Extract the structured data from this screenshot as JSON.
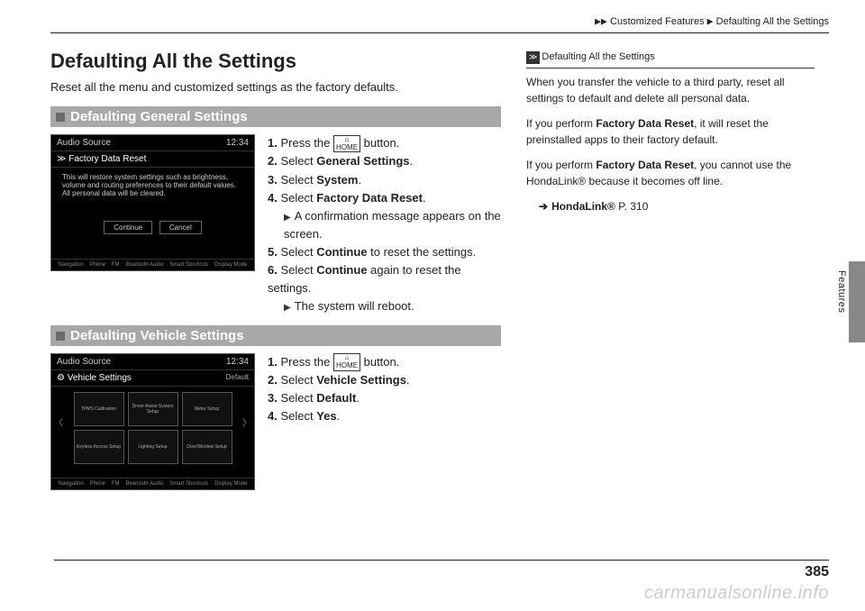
{
  "breadcrumb": {
    "level1": "Customized Features",
    "level2": "Defaulting All the Settings"
  },
  "title": "Defaulting All the Settings",
  "intro": "Reset all the menu and customized settings as the factory defaults.",
  "section1": {
    "heading": "Defaulting General Settings",
    "screenshot": {
      "audio_label": "Audio Source",
      "time": "12:34",
      "title_prefix": "≫",
      "title": "Factory Data Reset",
      "body": "This will restore system settings such as brightness, volume and routing preferences to their default values. All personal data will be cleared.",
      "btn_continue": "Continue",
      "btn_cancel": "Cancel",
      "nav_items": [
        "Navigation",
        "Phone",
        "FM",
        "Bluetooth Audio",
        "Smart Shortcuts",
        "Display Mode"
      ]
    },
    "steps": {
      "s1_prefix": "1.",
      "s1a": "Press the ",
      "home_icon_top": "⌂",
      "home_icon_bot": "HOME",
      "s1b": " button.",
      "s2_prefix": "2.",
      "s2a": "Select ",
      "s2b": "General Settings",
      "s2c": ".",
      "s3_prefix": "3.",
      "s3a": "Select ",
      "s3b": "System",
      "s3c": ".",
      "s4_prefix": "4.",
      "s4a": "Select ",
      "s4b": "Factory Data Reset",
      "s4c": ".",
      "s4_sub": "A confirmation message appears on the screen.",
      "s5_prefix": "5.",
      "s5a": "Select ",
      "s5b": "Continue",
      "s5c": " to reset the settings.",
      "s6_prefix": "6.",
      "s6a": "Select ",
      "s6b": "Continue",
      "s6c": " again to reset the settings.",
      "s6_sub": "The system will reboot."
    }
  },
  "section2": {
    "heading": "Defaulting Vehicle Settings",
    "screenshot": {
      "audio_label": "Audio Source",
      "time": "12:34",
      "title_prefix": "⚙",
      "title": "Vehicle Settings",
      "default_label": "Default",
      "tiles": [
        "TPMS Calibration",
        "Driver Assist System Setup",
        "Meter Setup",
        "Keyless Access Setup",
        "Lighting Setup",
        "Door/Window Setup"
      ],
      "nav_items": [
        "Navigation",
        "Phone",
        "FM",
        "Bluetooth Audio",
        "Smart Shortcuts",
        "Display Mode"
      ]
    },
    "steps": {
      "s1_prefix": "1.",
      "s1a": "Press the ",
      "s1b": " button.",
      "s2_prefix": "2.",
      "s2a": "Select ",
      "s2b": "Vehicle Settings",
      "s2c": ".",
      "s3_prefix": "3.",
      "s3a": "Select ",
      "s3b": "Default",
      "s3c": ".",
      "s4_prefix": "4.",
      "s4a": "Select ",
      "s4b": "Yes",
      "s4c": "."
    }
  },
  "sidebox": {
    "icon": "≫",
    "title": "Defaulting All the Settings",
    "p1": "When you transfer the vehicle to a third party, reset all settings to default and delete all personal data.",
    "p2a": "If you perform ",
    "p2b": "Factory Data Reset",
    "p2c": ", it will reset the preinstalled apps to their factory default.",
    "p3a": "If you perform ",
    "p3b": "Factory Data Reset",
    "p3c": ", you cannot use the HondaLink® because it becomes off line.",
    "link_label": "HondaLink®",
    "link_page": " P. 310"
  },
  "tab_label": "Features",
  "page_number": "385",
  "watermark": "carmanualsonline.info"
}
